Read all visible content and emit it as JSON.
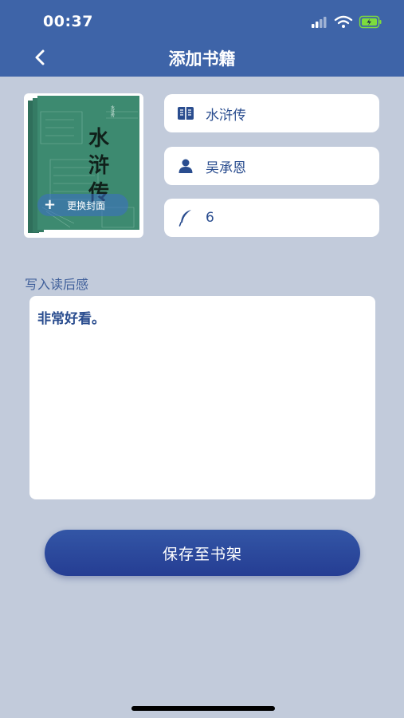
{
  "status_bar": {
    "time": "00:37"
  },
  "nav": {
    "title": "添加书籍"
  },
  "cover": {
    "upload_label": "更换封面"
  },
  "fields": {
    "book_title": "水浒传",
    "author": "吴承恩",
    "pages": "6"
  },
  "review": {
    "label": "写入读后感",
    "text": "非常好看。"
  },
  "save_button": {
    "label": "保存至书架"
  },
  "colors": {
    "header": "#3e64a8",
    "background": "#c2cbdb",
    "button": "#2c4a9c",
    "accent_text": "#2a4d8f",
    "battery": "#7ddc3c"
  }
}
